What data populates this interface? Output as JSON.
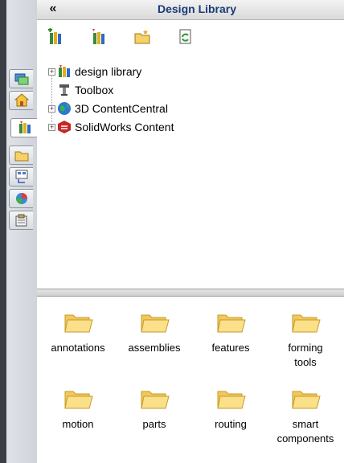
{
  "panel": {
    "title": "Design Library",
    "collapse_glyph": "«"
  },
  "toolbar": {
    "buttons": [
      {
        "name": "add-to-library",
        "icon": "add-to-library-icon"
      },
      {
        "name": "add-file-location",
        "icon": "add-file-location-icon"
      },
      {
        "name": "create-new-folder",
        "icon": "new-folder-icon"
      },
      {
        "name": "refresh",
        "icon": "refresh-icon"
      }
    ]
  },
  "side_tabs": [
    {
      "name": "solidworks-resources",
      "icon": "resources-icon"
    },
    {
      "name": "home",
      "icon": "home-icon"
    },
    {
      "name": "design-library",
      "icon": "design-library-icon",
      "active": true
    },
    {
      "name": "file-explorer",
      "icon": "folder-icon"
    },
    {
      "name": "view-palette",
      "icon": "view-palette-icon"
    },
    {
      "name": "appearances",
      "icon": "appearances-icon"
    },
    {
      "name": "custom-properties",
      "icon": "custom-properties-icon"
    }
  ],
  "tree": {
    "items": [
      {
        "label": "design library",
        "expandable": true,
        "icon": "design-library-icon"
      },
      {
        "label": "Toolbox",
        "expandable": false,
        "icon": "toolbox-icon"
      },
      {
        "label": "3D ContentCentral",
        "expandable": true,
        "icon": "globe-icon"
      },
      {
        "label": "SolidWorks Content",
        "expandable": true,
        "icon": "solidworks-icon"
      }
    ]
  },
  "folders": [
    {
      "label": "annotations"
    },
    {
      "label": "assemblies"
    },
    {
      "label": "features"
    },
    {
      "label": "forming tools"
    },
    {
      "label": "motion"
    },
    {
      "label": "parts"
    },
    {
      "label": "routing"
    },
    {
      "label": "smart components"
    }
  ],
  "colors": {
    "title_text": "#1a3b77",
    "folder_fill": "#f6d16a",
    "folder_edge": "#c79a2a"
  }
}
